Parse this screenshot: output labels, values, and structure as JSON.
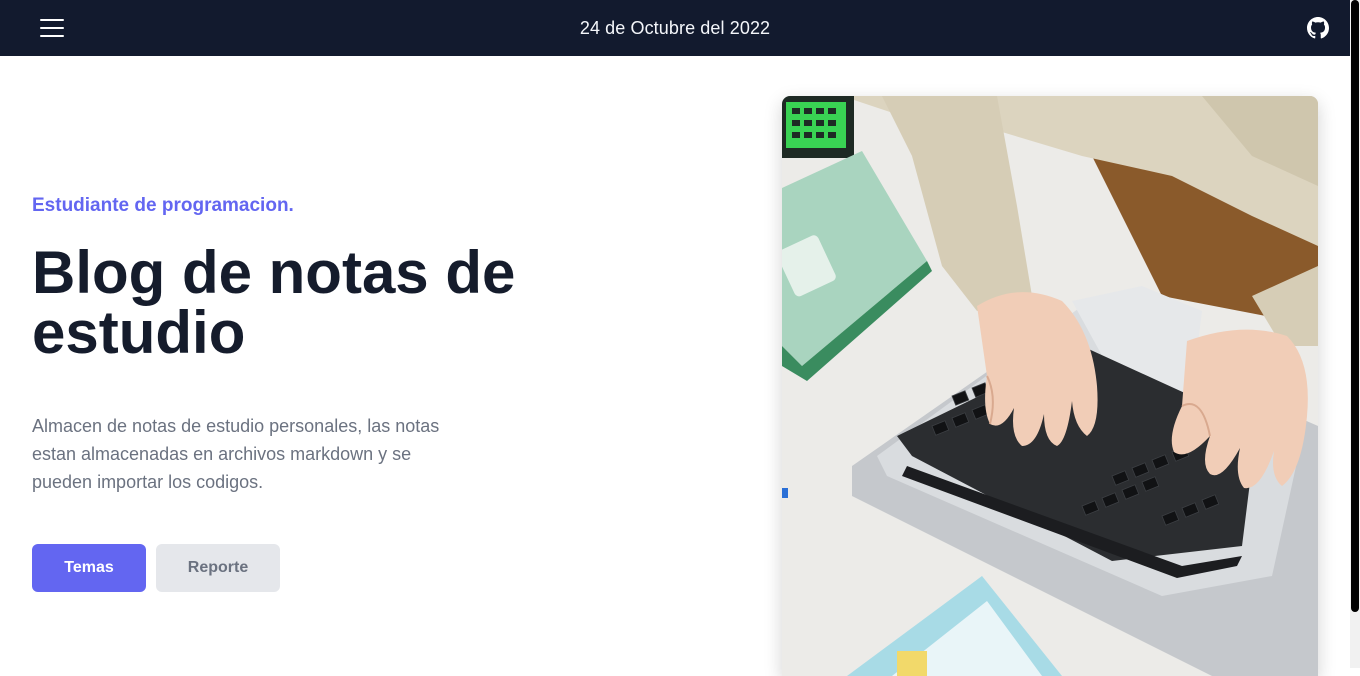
{
  "header": {
    "date": "24 de Octubre del 2022",
    "menu_icon": "hamburger-menu-icon",
    "github_icon": "github-icon"
  },
  "hero": {
    "kicker": "Estudiante de programacion.",
    "title": "Blog de notas de estudio",
    "description": "Almacen de notas de estudio personales, las notas estan almacenadas en archivos markdown y se pueden importar los codigos.",
    "buttons": {
      "primary": "Temas",
      "secondary": "Reporte"
    }
  },
  "image": {
    "subject": "hands typing on laptop keyboard"
  },
  "colors": {
    "nav_background": "#121a2e",
    "accent": "#6366f1",
    "heading": "#151c2c",
    "body_text": "#6b7280",
    "secondary_button": "#e5e7eb"
  }
}
